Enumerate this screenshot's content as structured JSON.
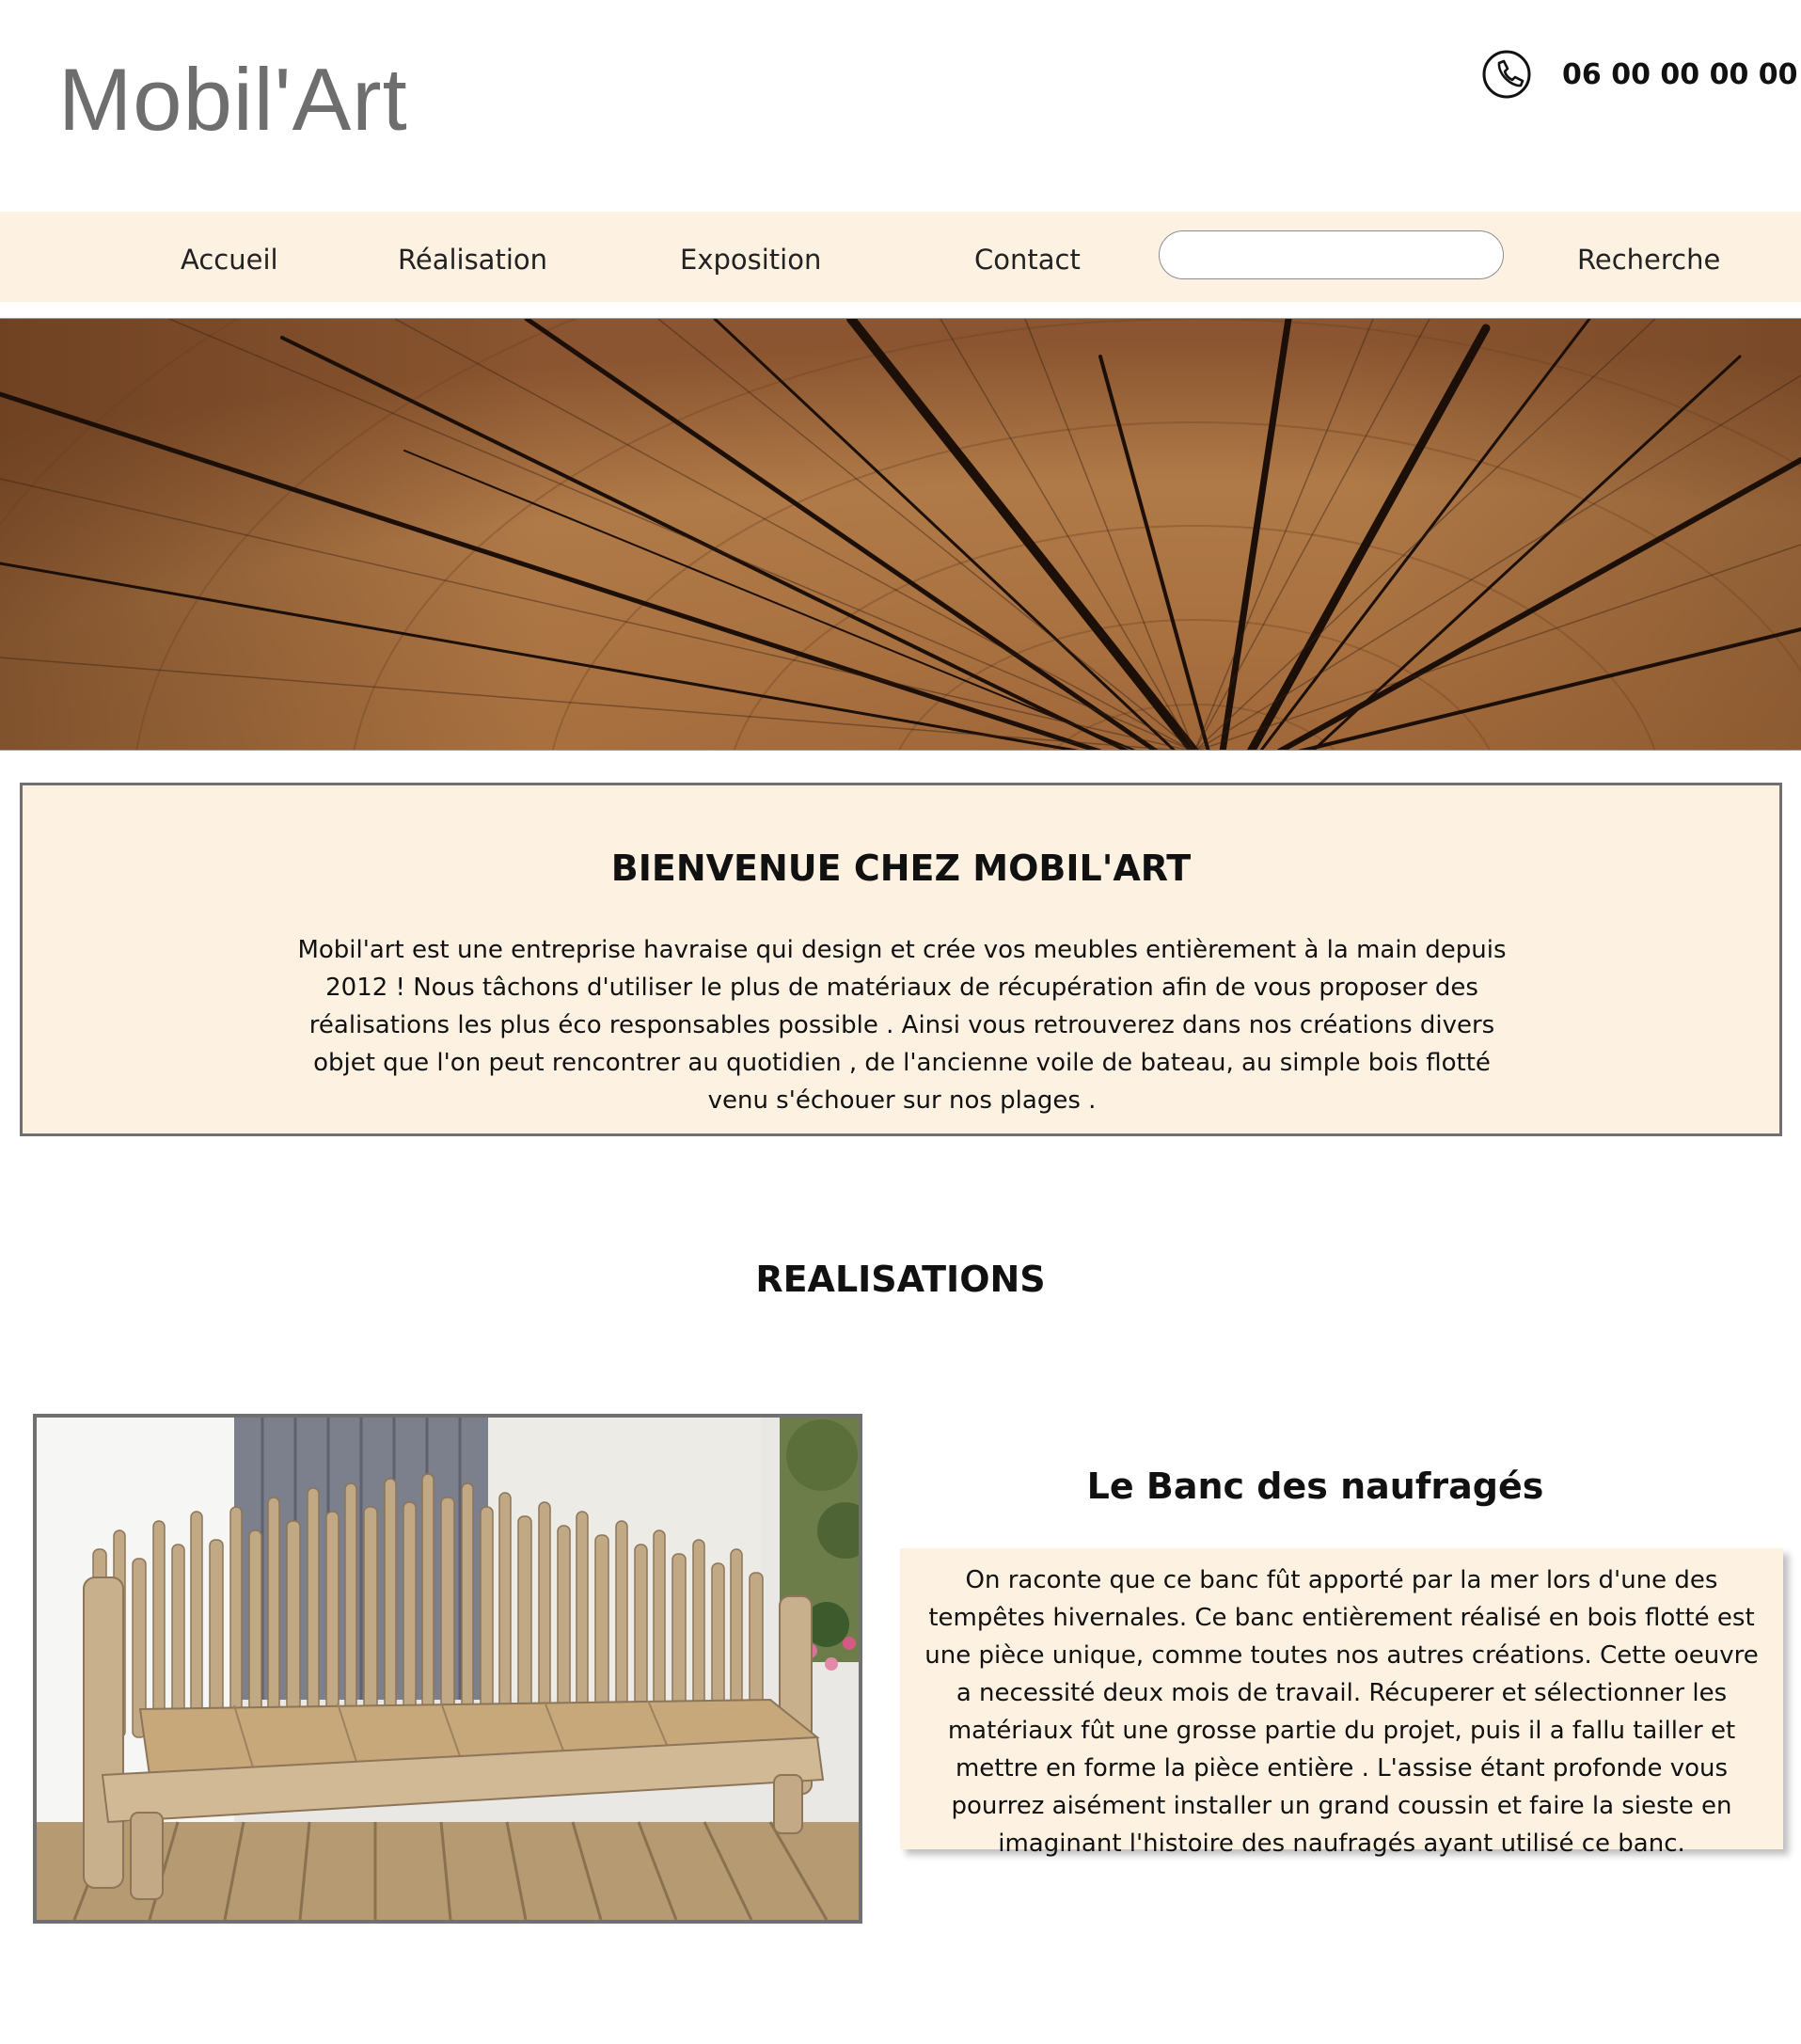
{
  "header": {
    "logo": "Mobil'Art",
    "phone": "06 00 00 00 00",
    "phone_icon": "phone-icon"
  },
  "nav": {
    "items": [
      "Accueil",
      "Réalisation",
      "Exposition",
      "Contact"
    ],
    "search_value": "",
    "search_button": "Recherche"
  },
  "colors": {
    "accent_background": "#fdf2e2",
    "border": "#707070",
    "logo": "#6e6e6e"
  },
  "welcome": {
    "title": "BIENVENUE CHEZ MOBIL'ART",
    "text": "Mobil'art est une entreprise havraise qui design et crée vos meubles entièrement à la main depuis 2012 ! Nous tâchons d'utiliser le plus de matériaux de récupération afin de vous proposer des réalisations les plus éco responsables possible . Ainsi vous retrouverez dans nos créations divers objet que l'on peut rencontrer au quotidien , de l'ancienne voile de bateau, au simple bois flotté venu s'échouer sur nos plages ."
  },
  "realisations": {
    "title": "REALISATIONS",
    "item": {
      "title": "Le Banc des naufragés",
      "description": "On raconte que ce banc fût apporté par la mer lors d'une des tempêtes hivernales. Ce banc entièrement réalisé en bois flotté est une pièce unique, comme toutes nos autres créations. Cette oeuvre a necessité deux mois de travail. Récuperer et sélectionner les matériaux fût une grosse partie du projet, puis il a fallu tailler et mettre en forme la pièce entière . L'assise étant profonde vous pourrez aisément installer un grand coussin et faire la sieste en imaginant l'histoire des naufragés ayant utilisé ce banc."
    }
  }
}
